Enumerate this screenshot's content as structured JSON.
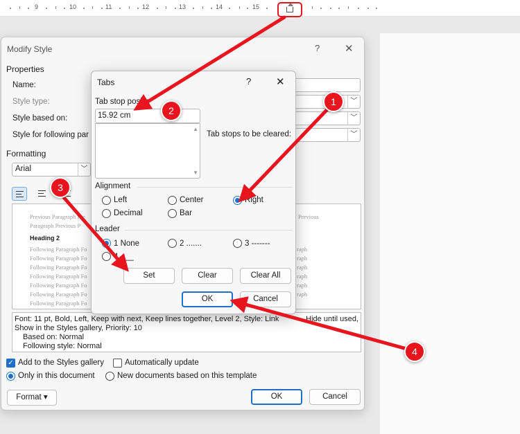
{
  "ruler": {
    "numbers": [
      "9",
      "10",
      "11",
      "12",
      "13",
      "14",
      "15"
    ]
  },
  "modify_style": {
    "title": "Modify Style",
    "help": "?",
    "close": "✕",
    "properties_label": "Properties",
    "name_label": "Name:",
    "style_type_label": "Style type:",
    "style_based_on_label": "Style based on:",
    "style_following_label": "Style for following par",
    "formatting_label": "Formatting",
    "font_value": "Arial",
    "preview": {
      "previous_1": "Previous Paragraph Pre",
      "previous_1_right": "Previous",
      "previous_2": "Paragraph Previous P",
      "heading": "Heading 2",
      "following_lines": [
        "Following Paragraph Fo",
        "Following Paragraph Fo",
        "Following Paragraph Fo",
        "Following Paragraph Fo",
        "Following Paragraph Fo",
        "Following Paragraph Fo",
        "Following Paragraph Fo",
        "Following Paragraph Fo"
      ],
      "right_col": "raph"
    },
    "description": {
      "line1": "Font: 11 pt, Bold, Left, Keep with next, Keep lines together, Level 2, Style: Link",
      "line1_right": "Hide until used,",
      "line2": "Show in the Styles gallery, Priority: 10",
      "line3": "Based on: Normal",
      "line4": "Following style: Normal"
    },
    "add_to_gallery": "Add to the Styles gallery",
    "auto_update": "Automatically update",
    "only_this_doc": "Only in this document",
    "new_docs": "New documents based on this template",
    "format_button": "Format ▾",
    "ok": "OK",
    "cancel": "Cancel"
  },
  "tabs_dialog": {
    "title": "Tabs",
    "help": "?",
    "close": "✕",
    "tab_stop_label": "Tab stop posi",
    "tab_stop_label_end": "n:",
    "tab_stop_value": "15.92 cm",
    "to_clear_label": "Tab stops to be cleared:",
    "alignment_label": "Alignment",
    "align_left": "Left",
    "align_center": "Center",
    "align_right": "Right",
    "align_decimal": "Decimal",
    "align_bar": "Bar",
    "leader_label": "Leader",
    "leader_1": "1 None",
    "leader_2": "2 .......",
    "leader_3": "3 -------",
    "leader_4": "4 ___",
    "set": "Set",
    "clear": "Clear",
    "clear_all": "Clear All",
    "ok": "OK",
    "cancel": "Cancel"
  },
  "annotations": {
    "badge_1": "1",
    "badge_2": "2",
    "badge_3": "3",
    "badge_4": "4",
    "color": "#e8141e"
  }
}
